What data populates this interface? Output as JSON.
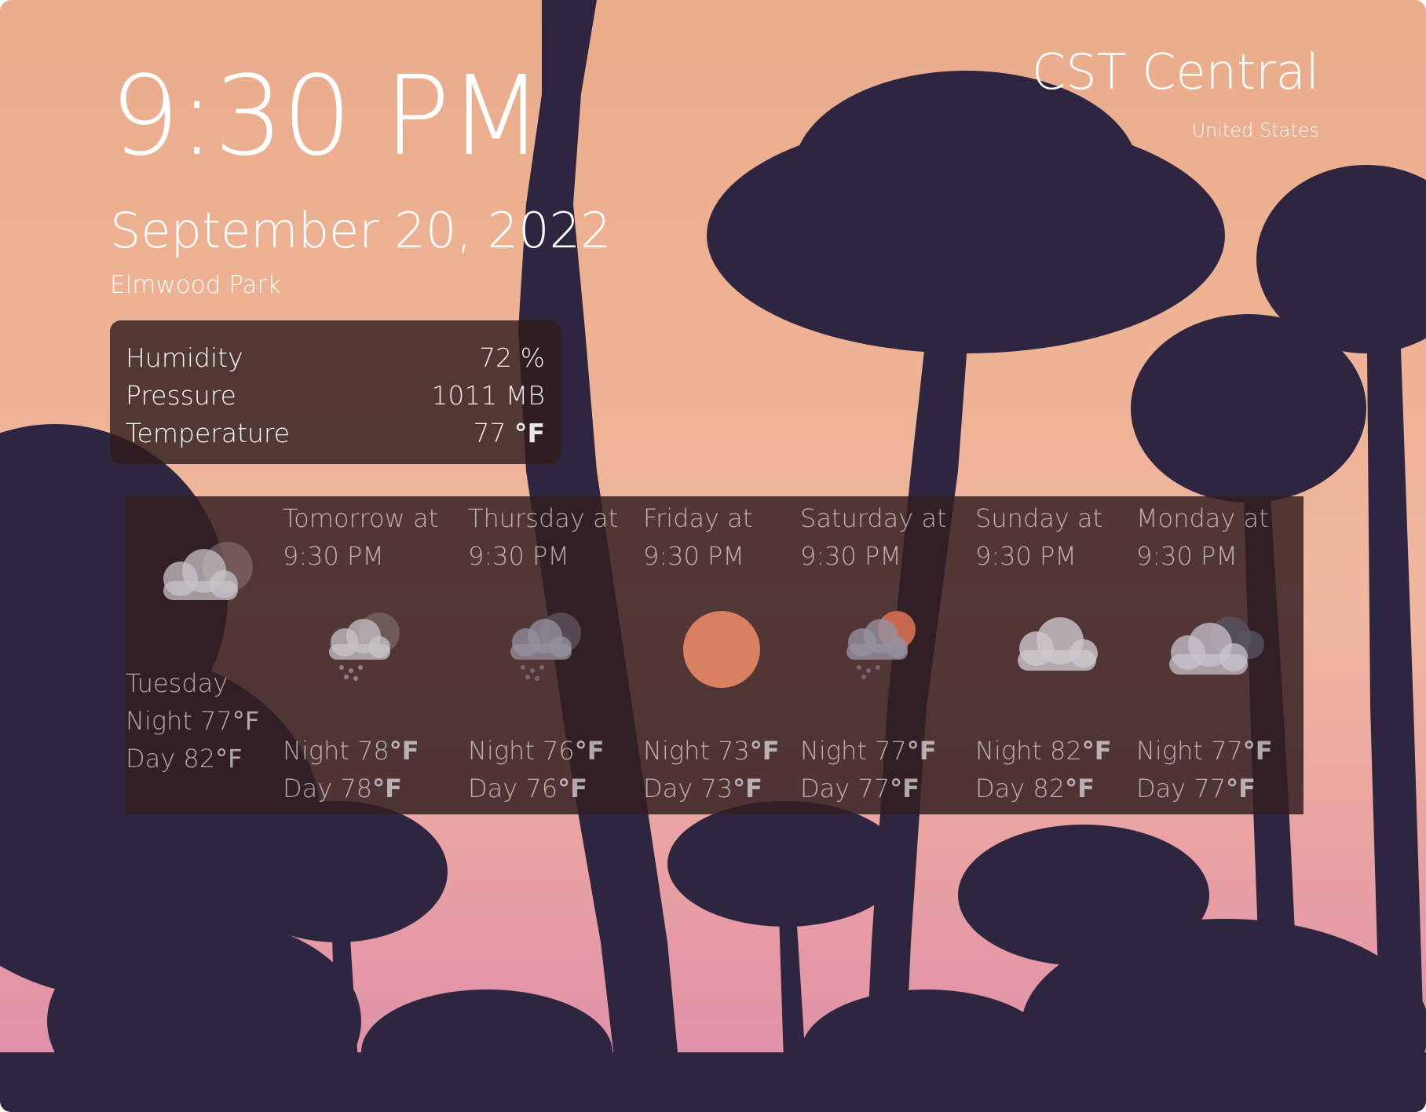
{
  "clock": {
    "time": "9:30 PM",
    "date": "September 20, 2022",
    "location": "Elmwood Park"
  },
  "timezone": {
    "name": "CST Central",
    "country": "United States"
  },
  "stats": [
    {
      "label": "Humidity",
      "value": "72 %"
    },
    {
      "label": "Pressure",
      "value": "1011 MB"
    },
    {
      "label": "Temperature",
      "value": "77",
      "unit": "°F"
    }
  ],
  "forecast": {
    "today": {
      "name": "Tuesday",
      "night": "Night 77",
      "day": "Day 82",
      "unit": "°F",
      "icon": "partly-cloudy-icon"
    },
    "days": [
      {
        "title": "Tomorrow at",
        "time": "9:30 PM",
        "night": "Night 78",
        "day": "Day 78",
        "unit": "°F",
        "icon": "rain-icon"
      },
      {
        "title": "Thursday at",
        "time": "9:30 PM",
        "night": "Night 76",
        "day": "Day 76",
        "unit": "°F",
        "icon": "rain-dark-icon"
      },
      {
        "title": "Friday at",
        "time": "9:30 PM",
        "night": "Night 73",
        "day": "Day 73",
        "unit": "°F",
        "icon": "sun-icon"
      },
      {
        "title": "Saturday at",
        "time": "9:30 PM",
        "night": "Night 77",
        "day": "Day 77",
        "unit": "°F",
        "icon": "sun-cloud-rain-icon"
      },
      {
        "title": "Sunday at",
        "time": "9:30 PM",
        "night": "Night 82",
        "day": "Day 82",
        "unit": "°F",
        "icon": "cloud-icon"
      },
      {
        "title": "Monday at",
        "time": "9:30 PM",
        "night": "Night 77",
        "day": "Day 77",
        "unit": "°F",
        "icon": "storm-cloud-icon"
      }
    ]
  },
  "colors": {
    "sun": "#d98062",
    "panel": "#301c1c",
    "palm": "#2e2540"
  }
}
